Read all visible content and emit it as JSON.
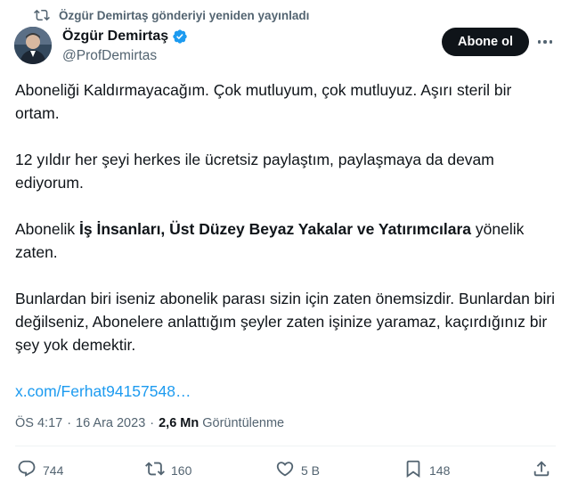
{
  "repost": {
    "text": "Özgür Demirtaş gönderiyi yeniden yayınladı",
    "icon": "repost-icon"
  },
  "author": {
    "name": "Özgür Demirtaş",
    "handle": "@ProfDemirtas",
    "verified_icon": "verified-badge-icon",
    "badge_color": "#1d9bf0"
  },
  "follow_button": {
    "label": "Abone ol"
  },
  "tweet": {
    "p1": "Aboneliği Kaldırmayacağım. Çok mutluyum, çok mutluyuz. Aşırı steril bir ortam.",
    "p2": "12 yıldır her şeyi herkes ile ücretsiz paylaştım, paylaşmaya da devam ediyorum.",
    "p3_before": "Abonelik ",
    "p3_bold": "İş İnsanları, Üst Düzey Beyaz Yakalar ve Yatırımcılara",
    "p3_after": " yönelik zaten.",
    "p4": "Bunlardan biri iseniz abonelik parası sizin için zaten önemsizdir. Bunlardan biri değilseniz, Abonelere anlattığım şeyler zaten işinize yaramaz, kaçırdığınız bir şey yok demektir.",
    "link": "x.com/Ferhat94157548…"
  },
  "meta": {
    "time": "ÖS 4:17",
    "separator": "·",
    "date": "16 Ara 2023",
    "views_count": "2,6 Mn",
    "views_label": "Görüntülenme"
  },
  "actions": {
    "replies": "744",
    "reposts": "160",
    "likes": "5 B",
    "bookmarks": "148"
  },
  "colors": {
    "accent": "#1d9bf0",
    "text": "#0f1419",
    "muted": "#536471"
  }
}
